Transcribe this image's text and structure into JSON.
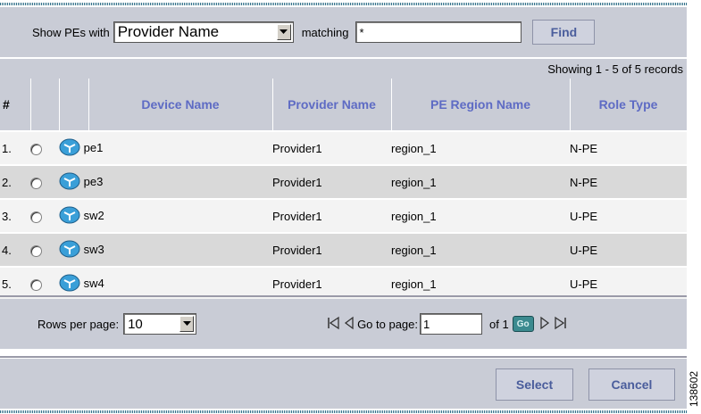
{
  "filter": {
    "show_label": "Show PEs with",
    "field_selected": "Provider Name",
    "matching_label": "matching",
    "matching_value": "*",
    "find_label": "Find"
  },
  "records_info": "Showing 1 - 5 of 5 records",
  "table": {
    "headers": {
      "num": "#",
      "device_name": "Device Name",
      "provider_name": "Provider Name",
      "pe_region_name": "PE Region Name",
      "role_type": "Role Type"
    },
    "rows": [
      {
        "num": "1.",
        "device": "pe1",
        "provider": "Provider1",
        "region": "region_1",
        "role": "N-PE"
      },
      {
        "num": "2.",
        "device": "pe3",
        "provider": "Provider1",
        "region": "region_1",
        "role": "N-PE"
      },
      {
        "num": "3.",
        "device": "sw2",
        "provider": "Provider1",
        "region": "region_1",
        "role": "U-PE"
      },
      {
        "num": "4.",
        "device": "sw3",
        "provider": "Provider1",
        "region": "region_1",
        "role": "U-PE"
      },
      {
        "num": "5.",
        "device": "sw4",
        "provider": "Provider1",
        "region": "region_1",
        "role": "U-PE"
      }
    ]
  },
  "pager": {
    "rows_per_page_label": "Rows per page:",
    "rows_per_page_value": "10",
    "go_to_page_label": "Go to page:",
    "page_value": "1",
    "of_label": "of 1",
    "go_label": "Go"
  },
  "actions": {
    "select_label": "Select",
    "cancel_label": "Cancel"
  },
  "figure_id": "138602",
  "icons": [
    "dropdown-arrow-icon",
    "device-icon",
    "first-page-icon",
    "prev-page-icon",
    "next-page-icon",
    "last-page-icon"
  ],
  "colors": {
    "panel": "#c9ccd6",
    "header_text": "#5e6bc4",
    "row_odd": "#f3f3f3",
    "row_even": "#d9d9d9"
  }
}
